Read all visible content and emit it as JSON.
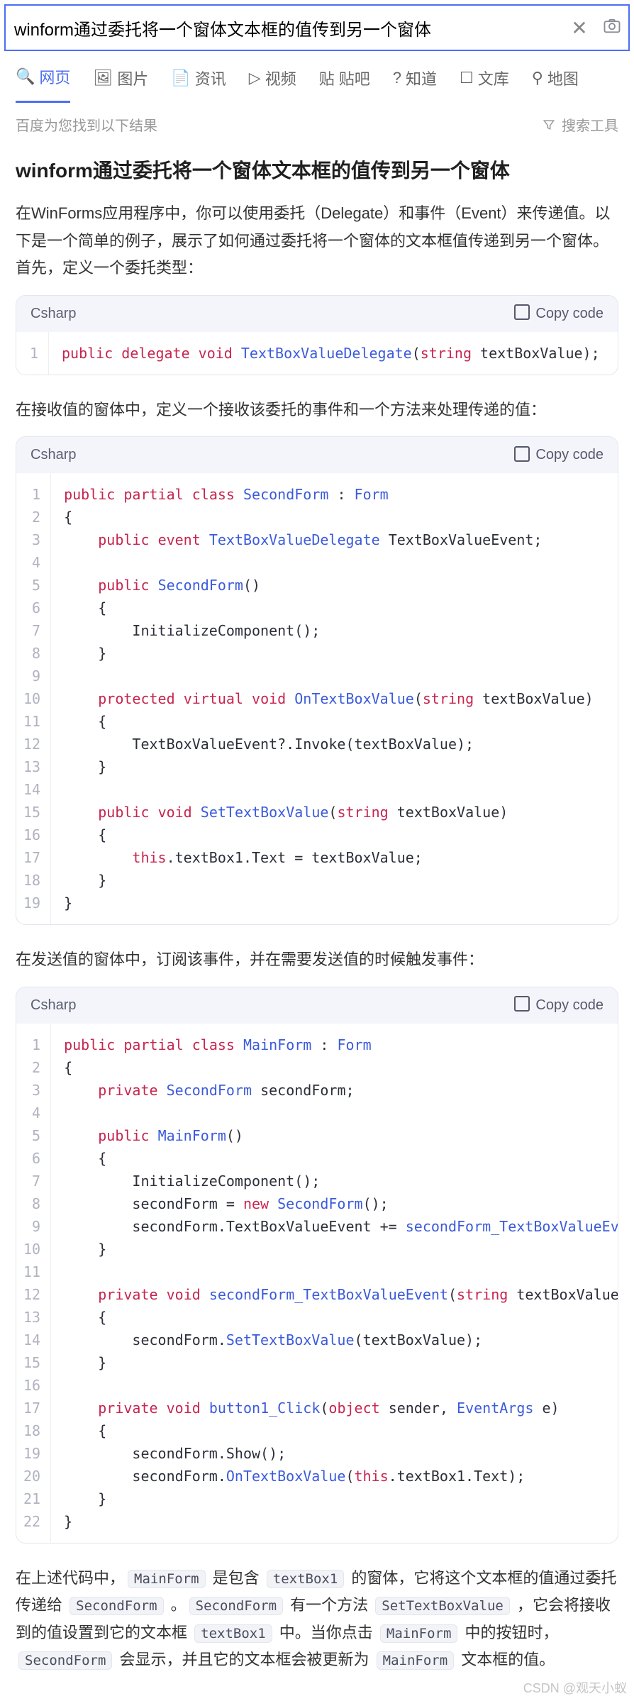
{
  "search": {
    "value": "winform通过委托将一个窗体文本框的值传到另一个窗体",
    "clear": "✕",
    "camera": "⦿"
  },
  "tabs": [
    "网页",
    "图片",
    "资讯",
    "视频",
    "贴吧",
    "知道",
    "文库",
    "地图"
  ],
  "subbar": {
    "left": "百度为您找到以下结果",
    "tools": "搜索工具"
  },
  "title": "winform通过委托将一个窗体文本框的值传到另一个窗体",
  "p1": "在WinForms应用程序中，你可以使用委托（Delegate）和事件（Event）来传递值。以下是一个简单的例子，展示了如何通过委托将一个窗体的文本框值传递到另一个窗体。",
  "p1b": "首先，定义一个委托类型：",
  "code_lang": "Csharp",
  "copy_label": "Copy code",
  "p2": "在接收值的窗体中，定义一个接收该委托的事件和一个方法来处理传递的值：",
  "p3": "在发送值的窗体中，订阅该事件，并在需要发送值的时候触发事件：",
  "p4_parts": [
    "在上述代码中，",
    "MainForm",
    " 是包含 ",
    "textBox1",
    " 的窗体，它将这个文本框的值通过委托传递给 ",
    "SecondForm",
    " 。",
    "SecondForm",
    " 有一个方法 ",
    "SetTextBoxValue",
    " ，它会将接收到的值设置到它的文本框 ",
    "textBox1",
    " 中。当你点击 ",
    "MainForm",
    " 中的按钮时，",
    "SecondForm",
    " 会显示，并且它的文本框会被更新为 ",
    "MainForm",
    " 文本框的值。"
  ],
  "watermark": "CSDN @观天小蚁",
  "chart_data": {
    "type": "table",
    "code_blocks": [
      {
        "language": "Csharp",
        "lines": [
          "public delegate void TextBoxValueDelegate(string textBoxValue);"
        ]
      },
      {
        "language": "Csharp",
        "lines": [
          "public partial class SecondForm : Form",
          "{",
          "    public event TextBoxValueDelegate TextBoxValueEvent;",
          "",
          "    public SecondForm()",
          "    {",
          "        InitializeComponent();",
          "    }",
          "",
          "    protected virtual void OnTextBoxValue(string textBoxValue)",
          "    {",
          "        TextBoxValueEvent?.Invoke(textBoxValue);",
          "    }",
          "",
          "    public void SetTextBoxValue(string textBoxValue)",
          "    {",
          "        this.textBox1.Text = textBoxValue;",
          "    }",
          "}"
        ]
      },
      {
        "language": "Csharp",
        "lines": [
          "public partial class MainForm : Form",
          "{",
          "    private SecondForm secondForm;",
          "",
          "    public MainForm()",
          "    {",
          "        InitializeComponent();",
          "        secondForm = new SecondForm();",
          "        secondForm.TextBoxValueEvent += secondForm_TextBoxValueEvent;",
          "    }",
          "",
          "    private void secondForm_TextBoxValueEvent(string textBoxValue)",
          "    {",
          "        secondForm.SetTextBoxValue(textBoxValue);",
          "    }",
          "",
          "    private void button1_Click(object sender, EventArgs e)",
          "    {",
          "        secondForm.Show();",
          "        secondForm.OnTextBoxValue(this.textBox1.Text);",
          "    }",
          "}"
        ]
      }
    ]
  }
}
